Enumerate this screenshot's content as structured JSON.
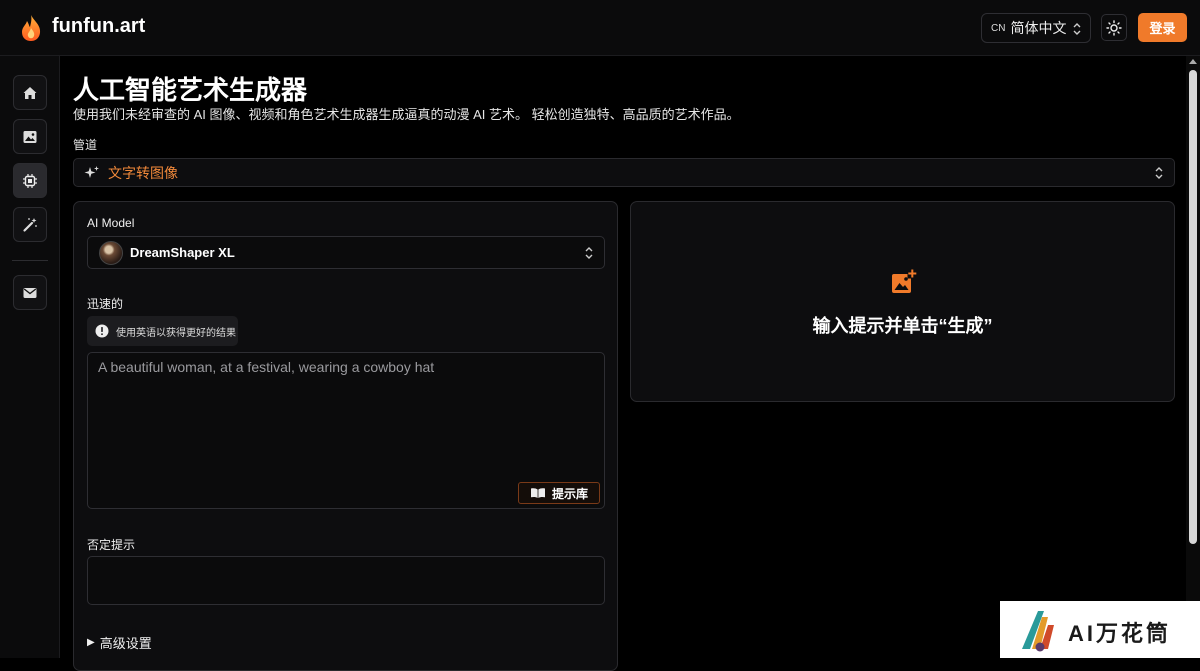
{
  "header": {
    "brand": "funfun.art",
    "language": {
      "code": "CN",
      "label": "简体中文"
    },
    "login_label": "登录"
  },
  "sidebar": {
    "items": [
      {
        "icon": "home-icon"
      },
      {
        "icon": "image-icon"
      },
      {
        "icon": "chip-icon",
        "active": true
      },
      {
        "icon": "magic-wand-icon"
      },
      {
        "icon": "mail-icon"
      }
    ]
  },
  "main": {
    "title": "人工智能艺术生成器",
    "subtitle": "使用我们未经审查的 AI 图像、视频和角色艺术生成器生成逼真的动漫 AI 艺术。 轻松创造独特、高品质的艺术作品。",
    "pipeline_label": "管道",
    "pipeline_value": "文字转图像"
  },
  "form": {
    "model_label": "AI Model",
    "model_value": "DreamShaper XL",
    "prompt_label": "迅速的",
    "prompt_hint": "使用英语以获得更好的结果",
    "prompt_placeholder": "A beautiful woman, at a festival, wearing a cowboy hat",
    "prompt_library_label": "提示库",
    "negative_label": "否定提示",
    "advanced_label": "高级设置"
  },
  "preview": {
    "empty_text": "输入提示并单击“生成”"
  },
  "watermark": {
    "text": "AI万花筒"
  },
  "colors": {
    "accent": "#f07a2a",
    "background": "#000000",
    "panel": "#0d0d0f",
    "border": "#2a2a2e"
  }
}
